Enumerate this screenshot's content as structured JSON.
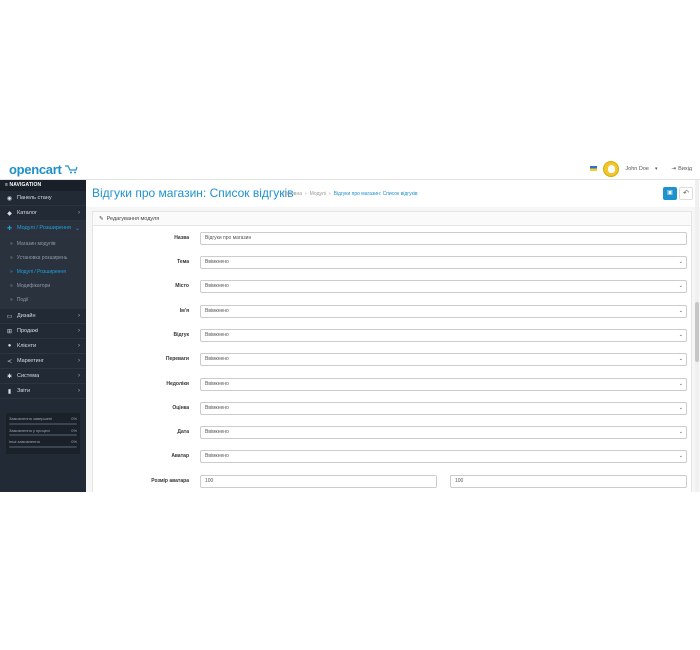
{
  "header": {
    "logo_text": "opencart",
    "user_name": "John Doe",
    "logout_label": "Вихід"
  },
  "sidebar": {
    "nav_header": "NAVIGATION",
    "items": [
      {
        "label": "Панель стану",
        "icon": "dashboard-icon"
      },
      {
        "label": "Каталог",
        "icon": "tag-icon"
      },
      {
        "label": "Модулі / Розширення",
        "icon": "puzzle-icon"
      },
      {
        "label": "Дизайн",
        "icon": "monitor-icon"
      },
      {
        "label": "Продажі",
        "icon": "cart-icon"
      },
      {
        "label": "Клієнти",
        "icon": "user-icon"
      },
      {
        "label": "Маркетинг",
        "icon": "share-icon"
      },
      {
        "label": "Система",
        "icon": "gear-icon"
      },
      {
        "label": "Звіти",
        "icon": "chart-icon"
      }
    ],
    "sub_items": [
      {
        "label": "Магазин модулів"
      },
      {
        "label": "Установка розширень"
      },
      {
        "label": "Модулі / Розширення"
      },
      {
        "label": "Модифікатори"
      },
      {
        "label": "Події"
      }
    ],
    "stats": [
      {
        "label": "Замовлення завершені",
        "value": "0%",
        "fraction": 0
      },
      {
        "label": "Замовлення у процесі",
        "value": "0%",
        "fraction": 0
      },
      {
        "label": "Інші замовлення",
        "value": "0%",
        "fraction": 0
      }
    ]
  },
  "main": {
    "title": "Відгуки про магазин: Список відгуків",
    "breadcrumb": [
      "Головна",
      "Модулі",
      "Відгуки про магазин: Список відгуків"
    ],
    "panel_title": "Редагування модуля",
    "fields": [
      {
        "label": "Назва",
        "value": "Відгуки про магазин",
        "type": "text"
      },
      {
        "label": "Тема",
        "value": "Ввімкнено",
        "type": "select"
      },
      {
        "label": "Місто",
        "value": "Ввімкнено",
        "type": "select"
      },
      {
        "label": "Ім'я",
        "value": "Ввімкнено",
        "type": "select"
      },
      {
        "label": "Відгук",
        "value": "Ввімкнено",
        "type": "select"
      },
      {
        "label": "Переваги",
        "value": "Ввімкнено",
        "type": "select"
      },
      {
        "label": "Недоліки",
        "value": "Ввімкнено",
        "type": "select"
      },
      {
        "label": "Оцінка",
        "value": "Ввімкнено",
        "type": "select"
      },
      {
        "label": "Дата",
        "value": "Ввімкнено",
        "type": "select"
      },
      {
        "label": "Аватар",
        "value": "Ввімкнено",
        "type": "select"
      }
    ],
    "avatar_size": {
      "label": "Розмір аватара",
      "width": "100",
      "height": "100"
    }
  },
  "colors": {
    "accent": "#1e91cf",
    "sidebar_bg": "#222a35"
  }
}
